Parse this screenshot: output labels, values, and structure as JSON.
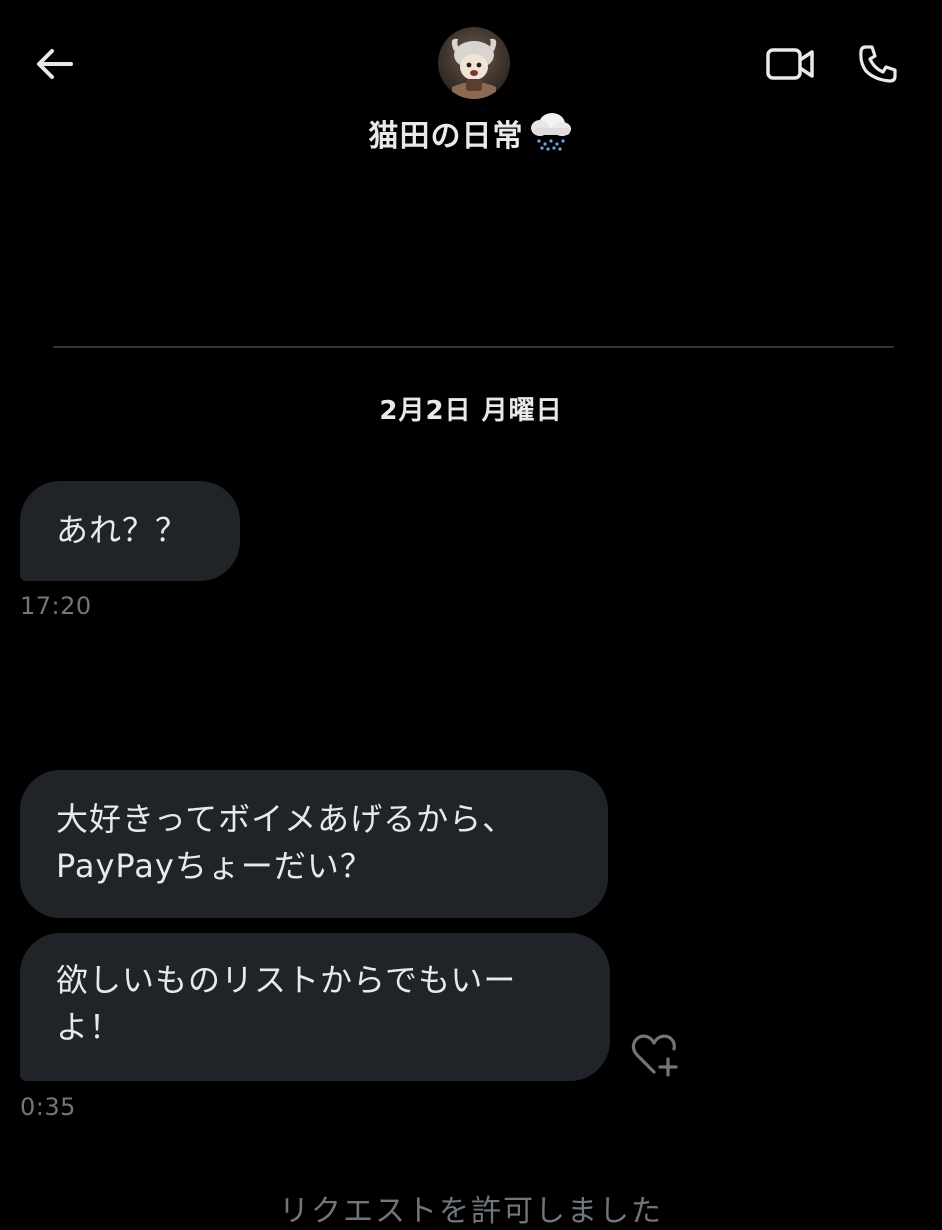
{
  "header": {
    "title": "猫田の日常",
    "title_emoji": "cloud-snow-emoji",
    "back_icon": "arrow-left-icon",
    "video_icon": "video-camera-icon",
    "call_icon": "phone-icon"
  },
  "conversation": {
    "date_separator": "2月2日 月曜日",
    "messages": [
      {
        "lines": [
          "あれ？？"
        ],
        "time": "17:20"
      },
      {
        "lines": [
          "大好きってボイメあげるから、",
          "PayPayちょーだい？"
        ]
      },
      {
        "lines": [
          "欲しいものリストからでもいー",
          "よ！"
        ],
        "time": "0:35"
      }
    ],
    "reaction_icon": "heart-plus-icon",
    "bottom_partial_text": "リクエストを許可しました"
  },
  "colors": {
    "background": "#000000",
    "bubble": "#202327",
    "text": "#e7e9ea",
    "muted": "#71767b",
    "divider": "#2f3336"
  }
}
